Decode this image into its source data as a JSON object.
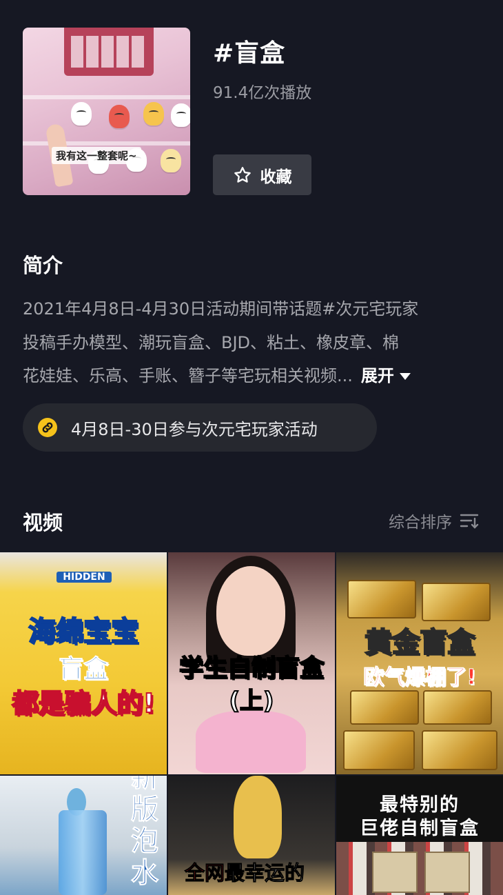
{
  "header": {
    "title": "#盲盒",
    "plays": "91.4亿次播放",
    "favorite_label": "收藏",
    "cover_caption": "我有这一整套呢~"
  },
  "intro": {
    "heading": "简介",
    "lines": [
      "2021年4月8日-4月30日活动期间带话题#次元宅玩家",
      "投稿手办模型、潮玩盲盒、BJD、粘土、橡皮章、棉",
      "花娃娃、乐高、手账、簪子等宅玩相关视频..."
    ],
    "expand_label": "展开"
  },
  "activity": {
    "label": "4月8日-30日参与次元宅玩家活动"
  },
  "videos": {
    "heading": "视频",
    "sort_label": "综合排序",
    "tiles": [
      {
        "lines": [
          "海绵宝宝",
          "盲盒",
          "都是骗人的!"
        ],
        "badge": "HIDDEN"
      },
      {
        "lines": [
          "学生自制盲盒",
          "(上)"
        ]
      },
      {
        "lines": [
          "黄金盲盒",
          "欧气爆棚了!"
        ]
      },
      {
        "lines": [
          "新",
          "版",
          "泡",
          "水"
        ]
      },
      {
        "lines": [
          "全网",
          "最幸运的"
        ]
      },
      {
        "lines": [
          "最特别的",
          "巨佬自制盲盒"
        ]
      }
    ]
  },
  "colors": {
    "background": "#161823",
    "button": "#393b44",
    "pill": "#26282f",
    "activity_icon": "#f5c21b"
  }
}
